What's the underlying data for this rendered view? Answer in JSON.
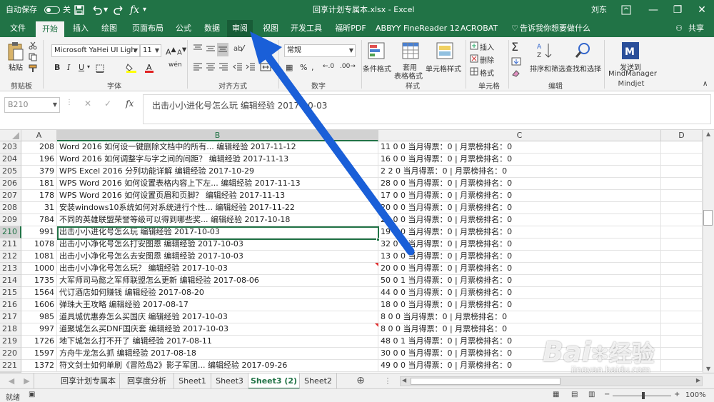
{
  "titlebar": {
    "autosave_label": "自动保存",
    "autosave_state": "关",
    "doc_title": "回享计划专属本.xlsx - Excel",
    "user": "刘东"
  },
  "ribbon_tabs": [
    "文件",
    "开始",
    "插入",
    "绘图",
    "页面布局",
    "公式",
    "数据",
    "审阅",
    "视图",
    "开发工具",
    "福昕PDF",
    "ABBYY FineReader 12",
    "ACROBAT"
  ],
  "ribbon_active_tab": "开始",
  "ribbon_highlighted_tab": "审阅",
  "tell_me": "告诉我你想要做什么",
  "share": "共享",
  "ribbon": {
    "paste": "粘贴",
    "clipboard": "剪贴板",
    "font_name": "Microsoft YaHei UI Ligh",
    "font_size": "11",
    "font_group": "字体",
    "align_group": "对齐方式",
    "number_format": "常规",
    "number_group": "数字",
    "cond_format": "条件格式",
    "table_format_1": "套用",
    "table_format_2": "表格格式",
    "cell_style": "单元格样式",
    "styles_group": "样式",
    "insert": "插入",
    "delete": "删除",
    "format": "格式",
    "cells_group": "单元格",
    "sort_filter": "排序和筛选",
    "find_select": "查找和选择",
    "edit_group": "编辑",
    "mm_1": "发送到",
    "mm_2": "MindManager",
    "mm_group": "Mindjet"
  },
  "formula_bar": {
    "name_box": "B210",
    "formula": "出击小小进化号怎么玩 编辑经验 2017-10-03"
  },
  "columns": [
    "A",
    "B",
    "C",
    "D"
  ],
  "selected_column": "B",
  "selected_row": "210",
  "rows": [
    {
      "r": "203",
      "a": "208",
      "b": "Word 2016 如何设一键删除文档中的所有... 编辑经验 2017-11-12",
      "c": "11 0 0 当月得票：0 | 月票榜排名：0"
    },
    {
      "r": "204",
      "a": "196",
      "b": "Word 2016 如何调整字与字之间的间距？ 编辑经验 2017-11-13",
      "c": "16 0 0 当月得票：0 | 月票榜排名：0"
    },
    {
      "r": "205",
      "a": "379",
      "b": "WPS Excel 2016 分列功能详解 编辑经验 2017-10-29",
      "c": "2 2 0 当月得票：0 | 月票榜排名：0"
    },
    {
      "r": "206",
      "a": "181",
      "b": "WPS Word 2016 如何设置表格内容上下左... 编辑经验 2017-11-13",
      "c": "28 0 0 当月得票：0 | 月票榜排名：0"
    },
    {
      "r": "207",
      "a": "178",
      "b": "WPS Word 2016 如何设置页眉和页脚？ 编辑经验 2017-11-13",
      "c": "17 0 0 当月得票：0 | 月票榜排名：0"
    },
    {
      "r": "208",
      "a": "31",
      "b": "安装windows10系统如何对系统进行个性... 编辑经验 2017-11-22",
      "c": "20 0 0 当月得票：0 | 月票榜排名：0"
    },
    {
      "r": "209",
      "a": "784",
      "b": "不同的英雄联盟荣誉等级可以得到哪些奖... 编辑经验 2017-10-18",
      "c": "20 0 0 当月得票：0 | 月票榜排名：0"
    },
    {
      "r": "210",
      "a": "991",
      "b": "出击小小进化号怎么玩 编辑经验 2017-10-03",
      "c": "19 0 0 当月得票：0 | 月票榜排名：0"
    },
    {
      "r": "211",
      "a": "1078",
      "b": "出击小小净化号怎么打安图恩 编辑经验 2017-10-03",
      "c": "32 0 0 当月得票：0 | 月票榜排名：0"
    },
    {
      "r": "212",
      "a": "1081",
      "b": "出击小小净化号怎么去安图恩 编辑经验 2017-10-03",
      "c": "13 0 0 当月得票：0 | 月票榜排名：0"
    },
    {
      "r": "213",
      "a": "1000",
      "b": "出击小小净化号怎么玩？ 编辑经验 2017-10-03",
      "c": "20 0 0 当月得票：0 | 月票榜排名：0"
    },
    {
      "r": "214",
      "a": "1735",
      "b": "大军师司马懿之军师联盟怎么更新 编辑经验 2017-08-06",
      "c": "50 0 1 当月得票：0 | 月票榜排名：0"
    },
    {
      "r": "215",
      "a": "1564",
      "b": "代订酒店如何赚钱 编辑经验 2017-08-20",
      "c": "44 0 0 当月得票：0 | 月票榜排名：0"
    },
    {
      "r": "216",
      "a": "1606",
      "b": "弹珠大王攻略 编辑经验 2017-08-17",
      "c": "18 0 0 当月得票：0 | 月票榜排名：0"
    },
    {
      "r": "217",
      "a": "985",
      "b": "道具城优惠券怎么买国庆 编辑经验 2017-10-03",
      "c": "8 0 0 当月得票：0 | 月票榜排名：0"
    },
    {
      "r": "218",
      "a": "997",
      "b": "道聚城怎么买DNF国庆套 编辑经验 2017-10-03",
      "c": "8 0 0 当月得票：0 | 月票榜排名：0"
    },
    {
      "r": "219",
      "a": "1726",
      "b": "地下城怎么打不开了 编辑经验 2017-08-11",
      "c": "48 0 1 当月得票：0 | 月票榜排名：0"
    },
    {
      "r": "220",
      "a": "1597",
      "b": "方舟牛龙怎么抓 编辑经验 2017-08-18",
      "c": "30 0 0 当月得票：0 | 月票榜排名：0"
    },
    {
      "r": "221",
      "a": "1372",
      "b": "符文剑士如何单刷《冒险岛2》影子军团... 编辑经验 2017-09-26",
      "c": "49 0 0 当月得票：0 | 月票榜排名：0"
    }
  ],
  "sheets": [
    "回享计划专属本",
    "回享度分析",
    "Sheet1",
    "Sheet3",
    "Sheet3 (2)",
    "Sheet2"
  ],
  "active_sheet": "Sheet3 (2)",
  "status": {
    "ready": "就绪",
    "zoom": "100%"
  },
  "watermark": {
    "brand": "Bai",
    "brand_cn": "经验",
    "url": "jingyan.baidu.com"
  },
  "colors": {
    "excel_green": "#217346",
    "arrow_blue": "#1a5fd8"
  }
}
